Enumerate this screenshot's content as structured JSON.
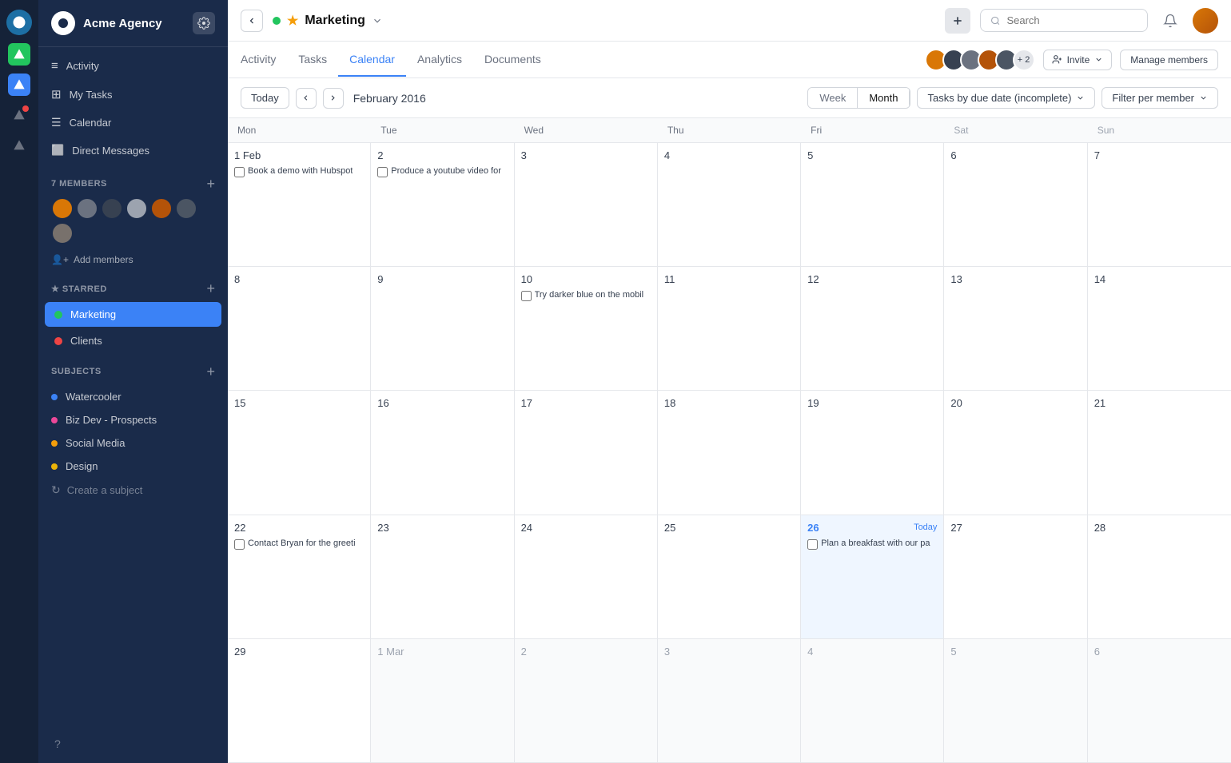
{
  "app": {
    "name": "Acme Agency"
  },
  "sidebar": {
    "nav": [
      {
        "id": "activity",
        "label": "Activity",
        "icon": "≡"
      },
      {
        "id": "my-tasks",
        "label": "My Tasks",
        "icon": "⊞"
      },
      {
        "id": "calendar",
        "label": "Calendar",
        "icon": "📅"
      },
      {
        "id": "direct-messages",
        "label": "Direct Messages",
        "icon": "💬"
      }
    ],
    "members_section": "7 MEMBERS",
    "add_members_label": "Add members",
    "starred_section": "★ STARRED",
    "starred": [
      {
        "id": "marketing",
        "label": "Marketing",
        "color": "#22c55e",
        "active": true
      },
      {
        "id": "clients",
        "label": "Clients",
        "color": "#ef4444",
        "active": false
      }
    ],
    "subjects_section": "SUBJECTS",
    "subjects": [
      {
        "id": "watercooler",
        "label": "Watercooler",
        "color": "#3b82f6"
      },
      {
        "id": "biz-dev",
        "label": "Biz Dev - Prospects",
        "color": "#ec4899"
      },
      {
        "id": "social-media",
        "label": "Social Media",
        "color": "#f59e0b"
      },
      {
        "id": "design",
        "label": "Design",
        "color": "#eab308"
      }
    ],
    "create_subject": "Create a subject",
    "help": "?"
  },
  "topbar": {
    "project_name": "Marketing",
    "search_placeholder": "Search"
  },
  "tabs": [
    {
      "id": "activity",
      "label": "Activity"
    },
    {
      "id": "tasks",
      "label": "Tasks"
    },
    {
      "id": "calendar",
      "label": "Calendar",
      "active": true
    },
    {
      "id": "analytics",
      "label": "Analytics"
    },
    {
      "id": "documents",
      "label": "Documents"
    }
  ],
  "tabs_right": {
    "plus_count": "+ 2",
    "invite_label": "Invite",
    "manage_members_label": "Manage members"
  },
  "calendar": {
    "today_label": "Today",
    "month_label": "February 2016",
    "week_btn": "Week",
    "month_btn": "Month",
    "filter_label": "Tasks by due date (incomplete)",
    "filter_member_label": "Filter per member",
    "day_headers": [
      "Mon",
      "Tue",
      "Wed",
      "Thu",
      "Fri",
      "Sat",
      "Sun"
    ],
    "weeks": [
      {
        "days": [
          {
            "date": "1 Feb",
            "other": false,
            "today": false,
            "tasks": [
              {
                "label": "Book a demo with Hubspot",
                "done": false
              }
            ]
          },
          {
            "date": "2",
            "other": false,
            "today": false,
            "tasks": [
              {
                "label": "Produce a youtube video for",
                "done": false
              }
            ]
          },
          {
            "date": "3",
            "other": false,
            "today": false,
            "tasks": []
          },
          {
            "date": "4",
            "other": false,
            "today": false,
            "tasks": []
          },
          {
            "date": "5",
            "other": false,
            "today": false,
            "tasks": []
          },
          {
            "date": "6",
            "other": false,
            "today": false,
            "tasks": []
          },
          {
            "date": "7",
            "other": false,
            "today": false,
            "tasks": []
          }
        ]
      },
      {
        "days": [
          {
            "date": "8",
            "other": false,
            "today": false,
            "tasks": []
          },
          {
            "date": "9",
            "other": false,
            "today": false,
            "tasks": []
          },
          {
            "date": "10",
            "other": false,
            "today": false,
            "tasks": [
              {
                "label": "Try darker blue on the mobil",
                "done": false
              }
            ]
          },
          {
            "date": "11",
            "other": false,
            "today": false,
            "tasks": []
          },
          {
            "date": "12",
            "other": false,
            "today": false,
            "tasks": []
          },
          {
            "date": "13",
            "other": false,
            "today": false,
            "tasks": []
          },
          {
            "date": "14",
            "other": false,
            "today": false,
            "tasks": []
          }
        ]
      },
      {
        "days": [
          {
            "date": "15",
            "other": false,
            "today": false,
            "tasks": []
          },
          {
            "date": "16",
            "other": false,
            "today": false,
            "tasks": []
          },
          {
            "date": "17",
            "other": false,
            "today": false,
            "tasks": []
          },
          {
            "date": "18",
            "other": false,
            "today": false,
            "tasks": []
          },
          {
            "date": "19",
            "other": false,
            "today": false,
            "tasks": []
          },
          {
            "date": "20",
            "other": false,
            "today": false,
            "tasks": []
          },
          {
            "date": "21",
            "other": false,
            "today": false,
            "tasks": []
          }
        ]
      },
      {
        "days": [
          {
            "date": "22",
            "other": false,
            "today": false,
            "tasks": [
              {
                "label": "Contact Bryan for the greeti",
                "done": false
              }
            ]
          },
          {
            "date": "23",
            "other": false,
            "today": false,
            "tasks": []
          },
          {
            "date": "24",
            "other": false,
            "today": false,
            "tasks": []
          },
          {
            "date": "25",
            "other": false,
            "today": false,
            "tasks": []
          },
          {
            "date": "26",
            "other": false,
            "today": true,
            "tasks": [
              {
                "label": "Plan a breakfast with our pa",
                "done": false
              }
            ]
          },
          {
            "date": "27",
            "other": false,
            "today": false,
            "tasks": []
          },
          {
            "date": "28",
            "other": false,
            "today": false,
            "tasks": []
          }
        ]
      },
      {
        "days": [
          {
            "date": "29",
            "other": false,
            "today": false,
            "tasks": []
          },
          {
            "date": "1 Mar",
            "other": true,
            "today": false,
            "tasks": []
          },
          {
            "date": "2",
            "other": true,
            "today": false,
            "tasks": []
          },
          {
            "date": "3",
            "other": true,
            "today": false,
            "tasks": []
          },
          {
            "date": "4",
            "other": true,
            "today": false,
            "tasks": []
          },
          {
            "date": "5",
            "other": true,
            "today": false,
            "tasks": []
          },
          {
            "date": "6",
            "other": true,
            "today": false,
            "tasks": []
          }
        ]
      }
    ]
  },
  "member_avatars": [
    {
      "bg": "#d97706"
    },
    {
      "bg": "#6b7280"
    },
    {
      "bg": "#374151"
    },
    {
      "bg": "#9ca3af"
    },
    {
      "bg": "#b45309"
    },
    {
      "bg": "#4b5563"
    },
    {
      "bg": "#78716c"
    }
  ]
}
